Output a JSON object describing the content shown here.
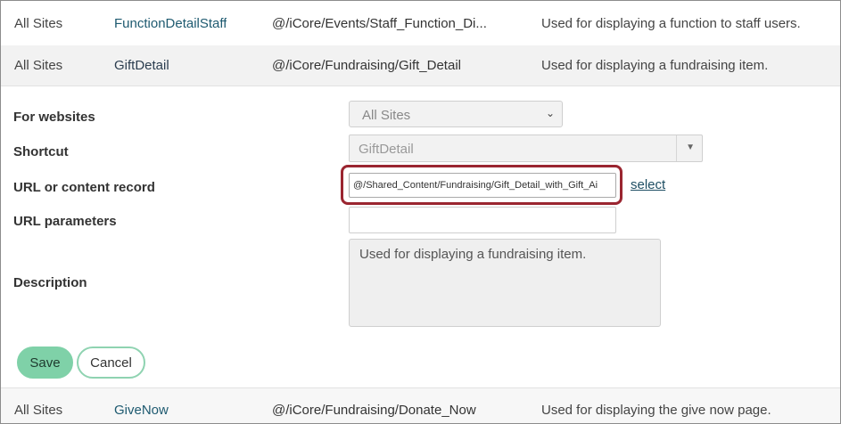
{
  "rows": [
    {
      "site": "All Sites",
      "shortcut": "FunctionDetailStaff",
      "url": "@/iCore/Events/Staff_Function_Di...",
      "description": "Used for displaying a function to staff users."
    },
    {
      "site": "All Sites",
      "shortcut": "GiftDetail",
      "url": "@/iCore/Fundraising/Gift_Detail",
      "description": "Used for displaying a fundraising item."
    }
  ],
  "form": {
    "websites_label": "For websites",
    "websites_value": "All Sites",
    "shortcut_label": "Shortcut",
    "shortcut_value": "GiftDetail",
    "url_label": "URL or content record",
    "url_value": "@/Shared_Content/Fundraising/Gift_Detail_with_Gift_Ai",
    "select_link": "select",
    "params_label": "URL parameters",
    "params_value": "",
    "description_label": "Description",
    "description_value": "Used for displaying a fundraising item.",
    "save_label": "Save",
    "cancel_label": "Cancel"
  },
  "bottom_row": {
    "site": "All Sites",
    "shortcut": "GiveNow",
    "url": "@/iCore/Fundraising/Donate_Now",
    "description": "Used for displaying the give now page."
  },
  "icons": {
    "select_chevron": "chevron-down-icon",
    "combo_caret": "caret-down-icon"
  },
  "colors": {
    "highlight_border": "#9a2530",
    "save_button": "#7fd1a8",
    "link": "#1e5a70"
  }
}
